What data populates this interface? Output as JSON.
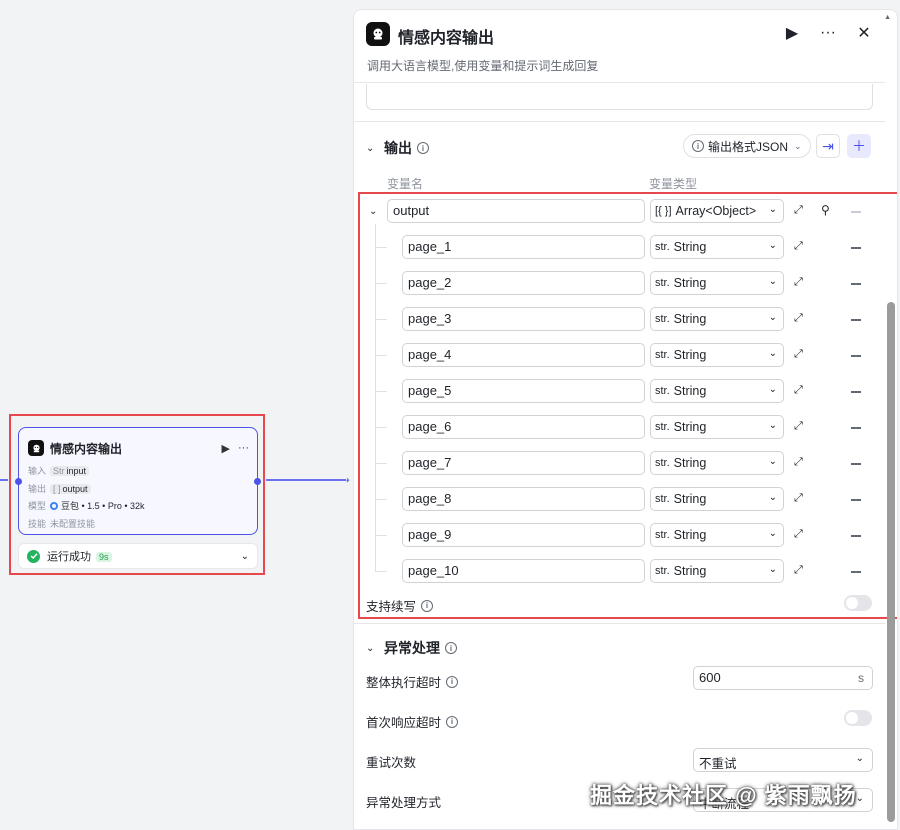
{
  "node": {
    "title": "情感内容输出",
    "run_icon": "▶",
    "more_icon": "···",
    "rows": [
      {
        "label": "输入",
        "type": "Str",
        "value": "input"
      },
      {
        "label": "输出",
        "type": "[ ]",
        "value": "output"
      },
      {
        "label": "模型",
        "value": "豆包 • 1.5 • Pro • 32k"
      },
      {
        "label": "技能",
        "value": "未配置技能"
      }
    ],
    "status": "运行成功",
    "duration": "9s"
  },
  "panel": {
    "title": "情感内容输出",
    "description": "调用大语言模型,使用变量和提示词生成回复",
    "actions": [
      "▶",
      "···",
      "✕"
    ]
  },
  "output_section": {
    "title": "输出",
    "format_button": "输出格式JSON",
    "col_name": "变量名",
    "col_type": "变量类型",
    "root": {
      "name": "output",
      "type_prefix": "[{ }]",
      "type": "Array<Object>"
    },
    "children": [
      {
        "name": "page_1",
        "type": "String"
      },
      {
        "name": "page_2",
        "type": "String"
      },
      {
        "name": "page_3",
        "type": "String"
      },
      {
        "name": "page_4",
        "type": "String"
      },
      {
        "name": "page_5",
        "type": "String"
      },
      {
        "name": "page_6",
        "type": "String"
      },
      {
        "name": "page_7",
        "type": "String"
      },
      {
        "name": "page_8",
        "type": "String"
      },
      {
        "name": "page_9",
        "type": "String"
      },
      {
        "name": "page_10",
        "type": "String"
      }
    ],
    "type_prefix": "str.",
    "continue_label": "支持续写"
  },
  "exception_section": {
    "title": "异常处理",
    "timeout_label": "整体执行超时",
    "timeout_value": "600",
    "timeout_unit": "s",
    "first_resp_label": "首次响应超时",
    "retry_label": "重试次数",
    "retry_value": "不重试",
    "handling_label": "异常处理方式",
    "handling_value": "中断流程"
  },
  "watermark": "掘金技术社区 @ 紫雨飘扬",
  "colors": {
    "accent": "#4d53e8",
    "highlight": "#e5484d",
    "success": "#22b35e"
  }
}
